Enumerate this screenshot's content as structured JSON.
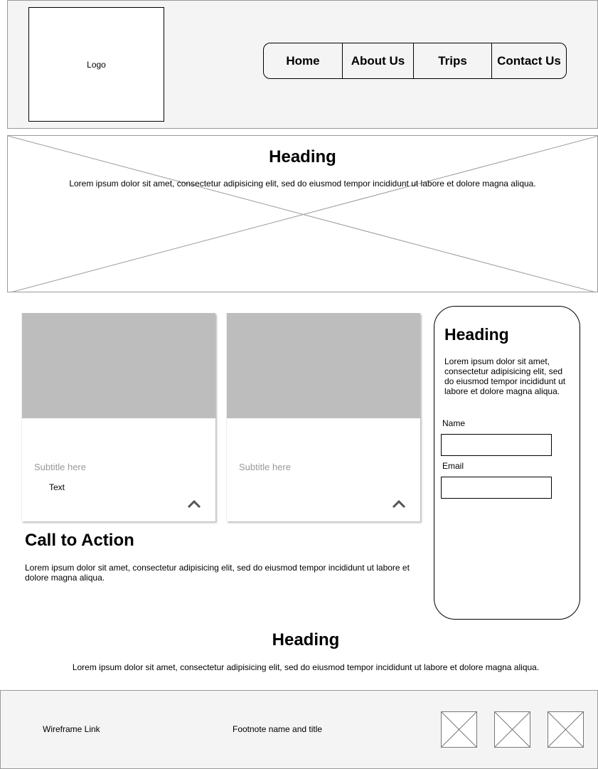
{
  "header": {
    "logo_label": "Logo",
    "nav": {
      "home": "Home",
      "about": "About Us",
      "trips": "Trips",
      "contact": "Contact Us"
    }
  },
  "hero": {
    "heading": "Heading",
    "text": "Lorem ipsum dolor sit amet, consectetur adipisicing elit, sed do eiusmod tempor incididunt ut labore et dolore magna aliqua."
  },
  "cards": [
    {
      "subtitle": "Subtitle here",
      "text": "Text",
      "toggle_icon": "chevron-up-icon"
    },
    {
      "subtitle": "Subtitle here",
      "text": "",
      "toggle_icon": "chevron-up-icon"
    }
  ],
  "cta": {
    "title": "Call to Action",
    "text": "Lorem ipsum dolor sit amet, consectetur adipisicing elit, sed do eiusmod tempor incididunt ut labore et dolore magna aliqua."
  },
  "sidebar": {
    "heading": "Heading",
    "text": "Lorem ipsum dolor sit amet, consectetur adipisicing elit, sed do eiusmod tempor incididunt ut labore et dolore magna aliqua.",
    "name_label": "Name",
    "name_value": "",
    "email_label": "Email",
    "email_value": ""
  },
  "section": {
    "heading": "Heading",
    "text": "Lorem ipsum dolor sit amet, consectetur adipisicing elit, sed do eiusmod tempor incididunt ut labore et dolore magna aliqua."
  },
  "footer": {
    "link": "Wireframe Link",
    "footnote": "Footnote name and title",
    "icons": [
      "image-placeholder-icon",
      "image-placeholder-icon",
      "image-placeholder-icon"
    ]
  },
  "colors": {
    "header_bg": "#f4f4f4",
    "image_placeholder": "#bdbdbd",
    "muted_text": "#999999"
  }
}
